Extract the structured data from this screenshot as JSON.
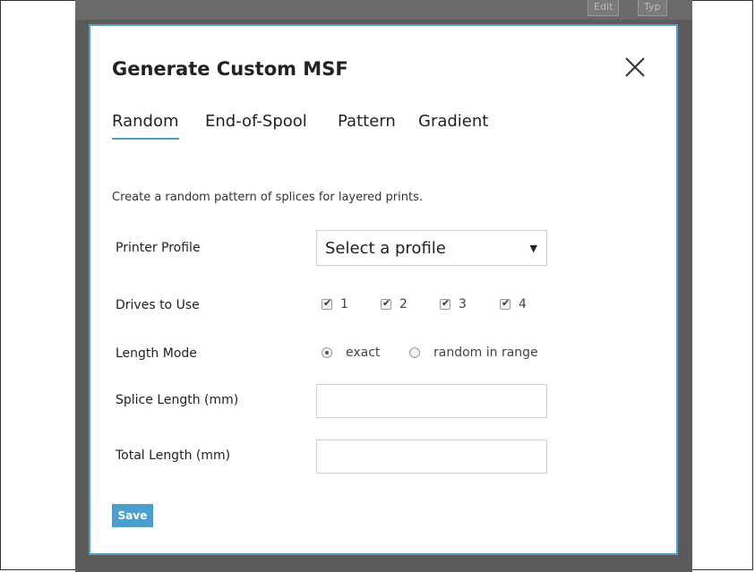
{
  "background": {
    "buttons": [
      "Edit",
      "Typ"
    ]
  },
  "modal": {
    "title": "Generate Custom MSF",
    "close_icon": "close-icon",
    "tabs": [
      {
        "label": "Random",
        "active": true
      },
      {
        "label": "End-of-Spool",
        "active": false
      },
      {
        "label": "Pattern",
        "active": false
      },
      {
        "label": "Gradient",
        "active": false
      }
    ],
    "description": "Create a random pattern of splices for layered prints.",
    "printer_profile": {
      "label": "Printer Profile",
      "value": "Select a profile"
    },
    "drives": {
      "label": "Drives to Use",
      "options": [
        {
          "label": "1",
          "checked": true
        },
        {
          "label": "2",
          "checked": true
        },
        {
          "label": "3",
          "checked": true
        },
        {
          "label": "4",
          "checked": true
        }
      ]
    },
    "length_mode": {
      "label": "Length Mode",
      "options": [
        {
          "label": "exact",
          "selected": true
        },
        {
          "label": "random in range",
          "selected": false
        }
      ]
    },
    "splice_length": {
      "label": "Splice Length (mm)",
      "value": ""
    },
    "total_length": {
      "label": "Total Length (mm)",
      "value": ""
    },
    "save_label": "Save"
  },
  "colors": {
    "accent": "#4ea0c8",
    "button": "#4ba0cf",
    "backdrop": "#5b5b5b"
  }
}
